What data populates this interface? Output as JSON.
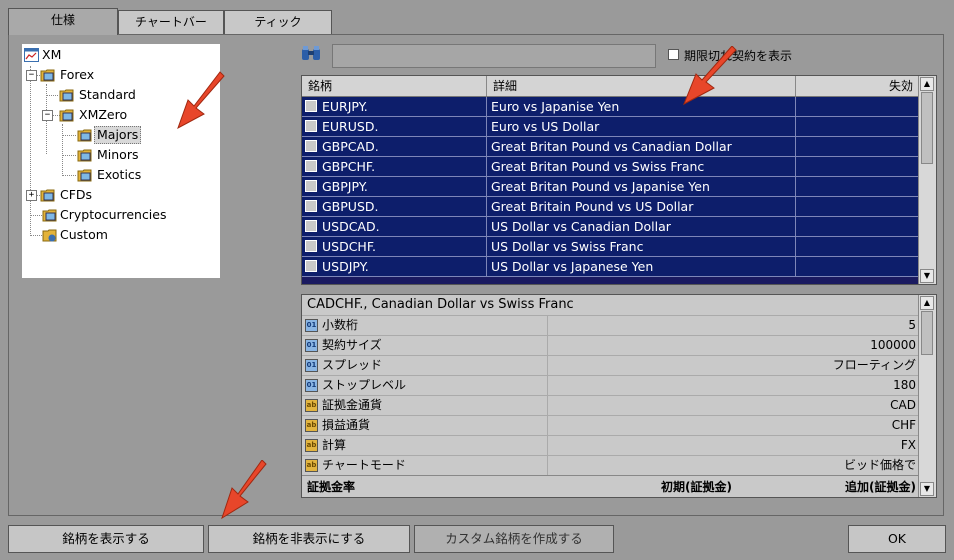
{
  "tabs": [
    "仕様",
    "チャートバー",
    "ティック"
  ],
  "tree": [
    {
      "label": "XM",
      "icon": "chart-icon"
    },
    {
      "label": "Forex",
      "icon": "folder-icon"
    },
    {
      "label": "Standard",
      "icon": "folder-icon"
    },
    {
      "label": "XMZero",
      "icon": "folder-icon"
    },
    {
      "label": "Majors",
      "icon": "folder-icon"
    },
    {
      "label": "Minors",
      "icon": "folder-icon"
    },
    {
      "label": "Exotics",
      "icon": "folder-icon"
    },
    {
      "label": "CFDs",
      "icon": "folder-icon"
    },
    {
      "label": "Cryptocurrencies",
      "icon": "folder-icon"
    },
    {
      "label": "Custom",
      "icon": "folder-icon"
    }
  ],
  "search": {
    "value": "",
    "checkbox_label": "期限切れ契約を表示"
  },
  "symbols_table": {
    "headers": [
      "銘柄",
      "詳細",
      "失効"
    ],
    "rows": [
      {
        "symbol": "EURJPY.",
        "description": "Euro vs Japanise Yen",
        "expiry": ""
      },
      {
        "symbol": "EURUSD.",
        "description": "Euro vs US Dollar",
        "expiry": ""
      },
      {
        "symbol": "GBPCAD.",
        "description": "Great Britan Pound vs Canadian Dollar",
        "expiry": ""
      },
      {
        "symbol": "GBPCHF.",
        "description": "Great Britan Pound vs Swiss Franc",
        "expiry": ""
      },
      {
        "symbol": "GBPJPY.",
        "description": "Great Britan Pound vs Japanise Yen",
        "expiry": ""
      },
      {
        "symbol": "GBPUSD.",
        "description": "Great Britain Pound vs US Dollar",
        "expiry": ""
      },
      {
        "symbol": "USDCAD.",
        "description": "US Dollar vs Canadian Dollar",
        "expiry": ""
      },
      {
        "symbol": "USDCHF.",
        "description": "US Dollar vs Swiss Franc",
        "expiry": ""
      },
      {
        "symbol": "USDJPY.",
        "description": "US Dollar vs Japanese Yen",
        "expiry": ""
      }
    ]
  },
  "properties": {
    "title": "CADCHF., Canadian Dollar vs Swiss Franc",
    "rows": [
      {
        "key": "小数桁",
        "value": "5",
        "kind": "num"
      },
      {
        "key": "契約サイズ",
        "value": "100000",
        "kind": "num"
      },
      {
        "key": "スプレッド",
        "value": "フローティング",
        "kind": "num"
      },
      {
        "key": "ストップレベル",
        "value": "180",
        "kind": "num"
      },
      {
        "key": "証拠金通貨",
        "value": "CAD",
        "kind": "str"
      },
      {
        "key": "損益通貨",
        "value": "CHF",
        "kind": "str"
      },
      {
        "key": "計算",
        "value": "FX",
        "kind": "str"
      },
      {
        "key": "チャートモード",
        "value": "ビッド価格で",
        "kind": "str"
      }
    ],
    "margin_header": {
      "label": "証拠金率",
      "initial": "初期(証拠金)",
      "additional": "追加(証拠金)"
    }
  },
  "buttons": {
    "show": "銘柄を表示する",
    "hide": "銘柄を非表示にする",
    "custom": "カスタム銘柄を作成する",
    "ok": "OK"
  },
  "colors": {
    "selection": "#0d1e6b",
    "annotation_arrow": "#e8462a"
  }
}
